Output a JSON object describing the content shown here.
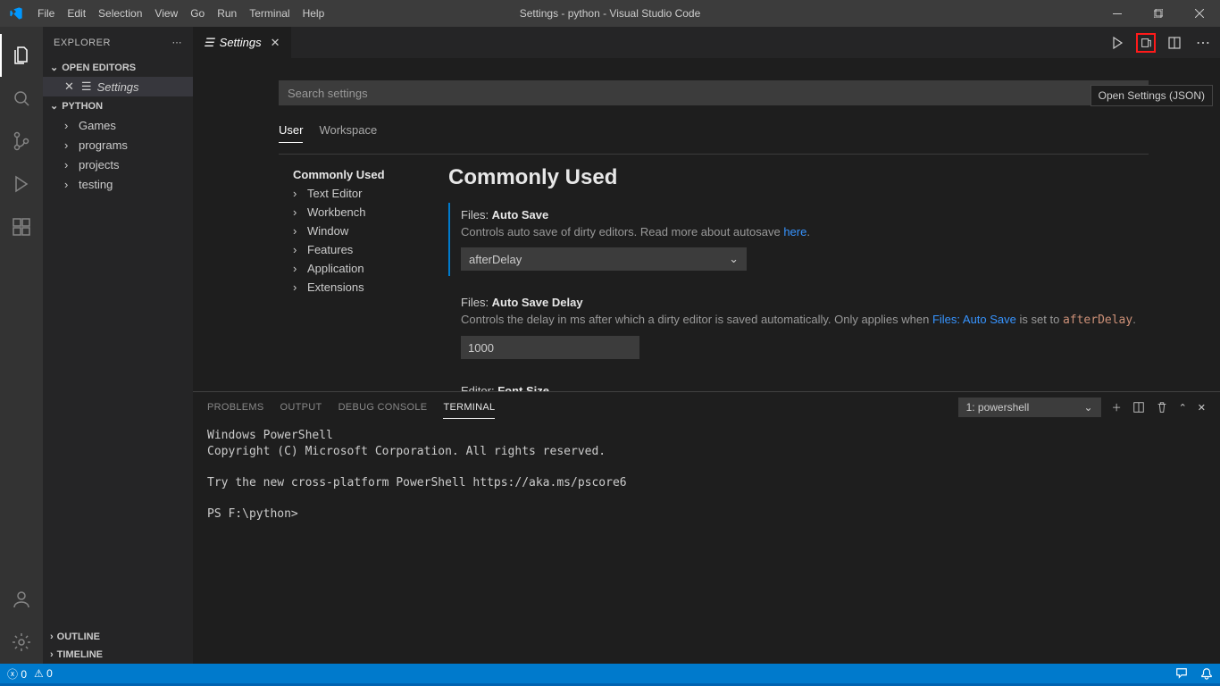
{
  "window": {
    "title": "Settings - python - Visual Studio Code"
  },
  "menu": [
    "File",
    "Edit",
    "Selection",
    "View",
    "Go",
    "Run",
    "Terminal",
    "Help"
  ],
  "explorer": {
    "title": "EXPLORER",
    "openEditors": "OPEN EDITORS",
    "openItem": "Settings",
    "root": "PYTHON",
    "folders": [
      "Games",
      "programs",
      "projects",
      "testing"
    ],
    "outline": "OUTLINE",
    "timeline": "TIMELINE"
  },
  "tab": {
    "label": "Settings"
  },
  "tooltip": "Open Settings (JSON)",
  "settings": {
    "searchPlaceholder": "Search settings",
    "scopes": [
      "User",
      "Workspace"
    ],
    "toc": [
      "Commonly Used",
      "Text Editor",
      "Workbench",
      "Window",
      "Features",
      "Application",
      "Extensions"
    ],
    "heading": "Commonly Used",
    "autoSave": {
      "prefix": "Files: ",
      "name": "Auto Save",
      "descA": "Controls auto save of dirty editors. Read more about autosave ",
      "link": "here",
      "descB": ".",
      "value": "afterDelay"
    },
    "autoSaveDelay": {
      "prefix": "Files: ",
      "name": "Auto Save Delay",
      "descA": "Controls the delay in ms after which a dirty editor is saved automatically. Only applies when ",
      "link": "Files: Auto Save",
      "descB": " is set to ",
      "code": "afterDelay",
      "descC": ".",
      "value": "1000"
    },
    "fontSize": {
      "prefix": "Editor: ",
      "name": "Font Size"
    }
  },
  "panel": {
    "tabs": [
      "PROBLEMS",
      "OUTPUT",
      "DEBUG CONSOLE",
      "TERMINAL"
    ],
    "termSel": "1: powershell",
    "lines": "Windows PowerShell\nCopyright (C) Microsoft Corporation. All rights reserved.\n\nTry the new cross-platform PowerShell https://aka.ms/pscore6\n\nPS F:\\python>"
  },
  "status": {
    "errors": "0",
    "warnings": "0"
  }
}
